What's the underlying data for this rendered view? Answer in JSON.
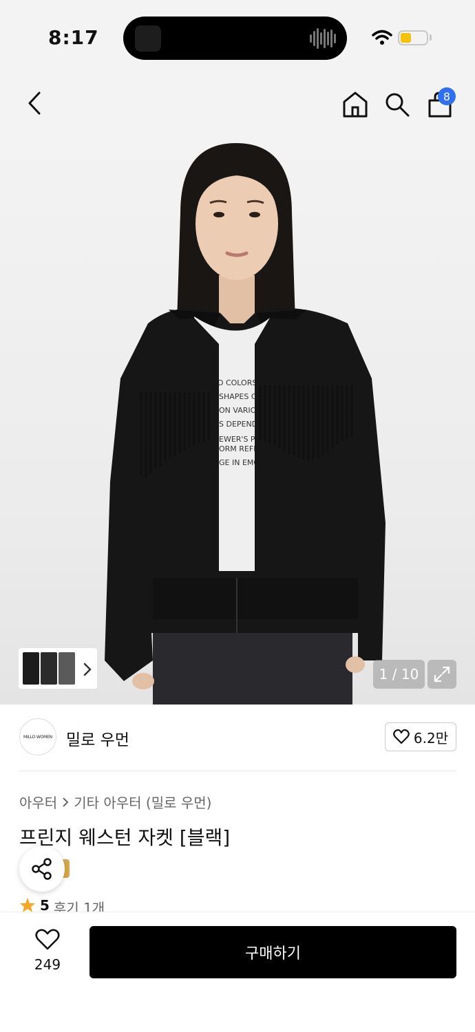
{
  "status_bar": {
    "time": "8:17"
  },
  "header": {
    "back_icon": "chevron-left-icon",
    "home_icon": "home-icon",
    "search_icon": "search-icon",
    "cart_icon": "shopping-bag-icon",
    "cart_badge": "8",
    "badge_color": "#2f6ff0"
  },
  "gallery": {
    "counter": "1 / 10",
    "expand_icon": "expand-icon"
  },
  "brand": {
    "logo_text": "MILLO WOMEN",
    "name": "밀로 우먼",
    "likes": "6.2만"
  },
  "product": {
    "breadcrumb": [
      "아우터",
      "기타 아우터 (밀로 우먼)"
    ],
    "title": "프린지 웨스턴 자켓 [블랙]",
    "rating": "5",
    "review_text": "후기 1개",
    "star_color": "#f5a623"
  },
  "bottom_bar": {
    "wish_count": "249",
    "buy_label": "구매하기"
  }
}
